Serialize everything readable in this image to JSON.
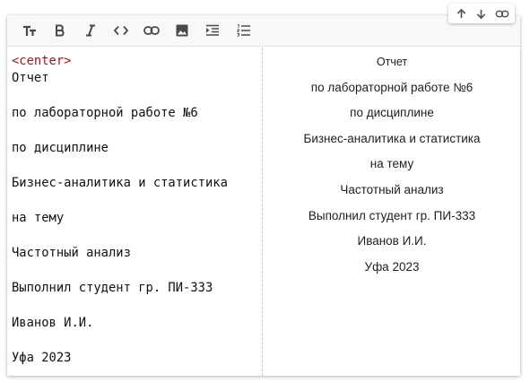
{
  "toolbar": {
    "buttons": [
      {
        "name": "text-size",
        "icon": "text-size-icon",
        "glyph": "TT"
      },
      {
        "name": "bold",
        "icon": "bold-icon",
        "glyph": "B"
      },
      {
        "name": "italic",
        "icon": "italic-icon",
        "glyph": "I"
      },
      {
        "name": "code",
        "icon": "code-icon",
        "glyph": "<>"
      },
      {
        "name": "link",
        "icon": "link-icon",
        "glyph": "link"
      },
      {
        "name": "image",
        "icon": "image-icon",
        "glyph": "img"
      },
      {
        "name": "indent",
        "icon": "indent-icon",
        "glyph": "ind"
      },
      {
        "name": "numbered-list",
        "icon": "numbered-list-icon",
        "glyph": "ol"
      }
    ]
  },
  "floating_toolbar": {
    "buttons": [
      {
        "name": "move-up",
        "icon": "arrow-up-icon"
      },
      {
        "name": "move-down",
        "icon": "arrow-down-icon"
      },
      {
        "name": "link",
        "icon": "link-icon"
      }
    ]
  },
  "source": {
    "tag": "<center>",
    "lines": [
      "Отчет",
      "по лабораторной работе №6",
      "по дисциплине",
      "Бизнес-аналитика и статистика",
      "на тему",
      "Частотный анализ",
      "Выполнил студент гр. ПИ-333",
      "Иванов И.И.",
      "Уфа 2023"
    ]
  },
  "preview": {
    "lines": [
      "Отчет",
      "по лабораторной работе №6",
      "по дисциплине",
      "Бизнес-аналитика и статистика",
      "на тему",
      "Частотный анализ",
      "Выполнил студент гр. ПИ-333",
      "Иванов И.И.",
      "Уфа 2023"
    ]
  },
  "colors": {
    "tag": "#a31515",
    "icon": "#4a4a4a",
    "toolbar_bg": "#f8f8f8"
  }
}
